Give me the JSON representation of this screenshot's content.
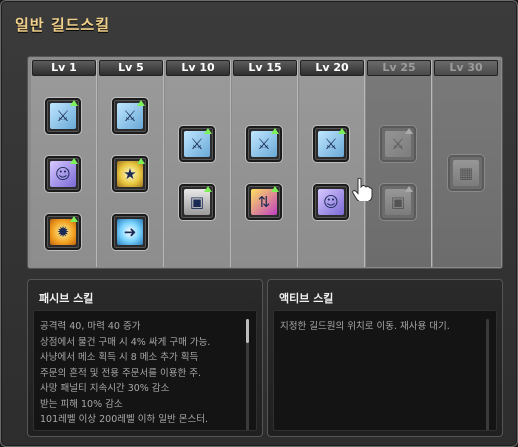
{
  "window": {
    "title": "일반 길드스킬"
  },
  "levels": [
    {
      "label": "Lv 1",
      "locked": false,
      "skills": [
        "sword-upgrade-icon",
        "guild-member-icon",
        "sun-buff-icon"
      ]
    },
    {
      "label": "Lv 5",
      "locked": false,
      "skills": [
        "sword-upgrade-icon",
        "star-buff-icon",
        "portal-orb-icon"
      ]
    },
    {
      "label": "Lv 10",
      "locked": false,
      "skills": [
        "sword-upgrade-icon",
        "id-card-icon"
      ]
    },
    {
      "label": "Lv 15",
      "locked": false,
      "skills": [
        "sword-upgrade-icon",
        "exchange-arrows-icon"
      ]
    },
    {
      "label": "Lv 20",
      "locked": false,
      "skills": [
        "sword-upgrade-icon",
        "guild-member-icon"
      ]
    },
    {
      "label": "Lv 25",
      "locked": true,
      "skills": [
        "sword-upgrade-icon",
        "id-card-icon"
      ]
    },
    {
      "label": "Lv 30",
      "locked": true,
      "skills": [
        "guild-building-icon"
      ]
    }
  ],
  "passive": {
    "title": "패시브 스킬",
    "lines": [
      "공격력 40, 마력 40 증가",
      "상점에서 물건 구매 시 4% 싸게 구매 가능.",
      "사냥에서 메소 획득 시 8 메소 추가 획득",
      "주문의 흔적 및 전용 주문서를 이용한 주.",
      "사망 패널티 지속시간 30% 감소",
      "받는 피해 10% 감소",
      "101레벨 이상 200레벨 이하 일반 몬스터."
    ]
  },
  "active": {
    "title": "액티브 스킬",
    "lines": [
      "지정한 길드원의 위치로 이동. 재사용 대기."
    ]
  },
  "colors": {
    "title": "#f0d08a",
    "level_up_arrow": "#7ef05a"
  }
}
